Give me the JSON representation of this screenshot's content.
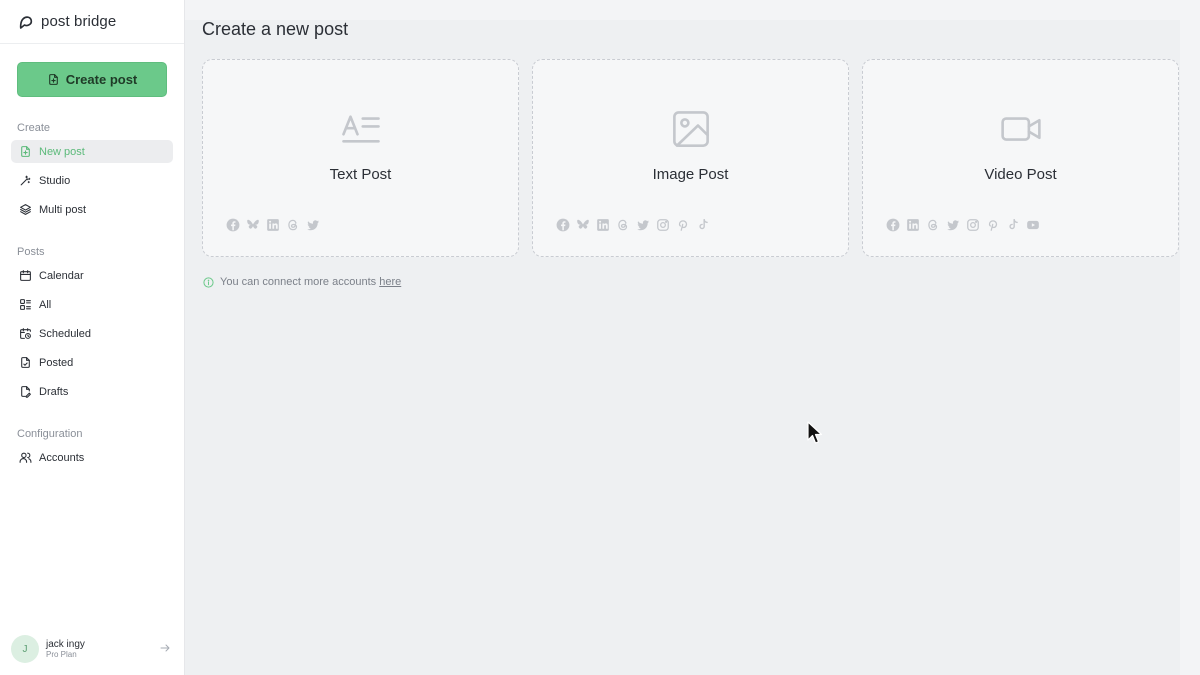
{
  "brand": {
    "name": "post bridge"
  },
  "sidebar": {
    "create_button": "Create post",
    "sections": [
      {
        "label": "Create",
        "items": [
          {
            "label": "New post",
            "icon": "file-plus-icon",
            "active": true
          },
          {
            "label": "Studio",
            "icon": "magic-wand-icon"
          },
          {
            "label": "Multi post",
            "icon": "layers-icon"
          }
        ]
      },
      {
        "label": "Posts",
        "items": [
          {
            "label": "Calendar",
            "icon": "calendar-icon"
          },
          {
            "label": "All",
            "icon": "list-grid-icon"
          },
          {
            "label": "Scheduled",
            "icon": "calendar-clock-icon"
          },
          {
            "label": "Posted",
            "icon": "file-check-icon"
          },
          {
            "label": "Drafts",
            "icon": "file-pen-icon"
          }
        ]
      },
      {
        "label": "Configuration",
        "items": [
          {
            "label": "Accounts",
            "icon": "users-icon"
          }
        ]
      }
    ],
    "user": {
      "initial": "J",
      "name": "jack ingy",
      "plan": "Pro Plan"
    }
  },
  "main": {
    "title": "Create a new post",
    "cards": [
      {
        "title": "Text Post",
        "icon": "text-align-icon",
        "platforms": [
          "facebook",
          "bluesky",
          "linkedin",
          "threads",
          "twitter"
        ]
      },
      {
        "title": "Image Post",
        "icon": "image-icon",
        "platforms": [
          "facebook",
          "bluesky",
          "linkedin",
          "threads",
          "twitter",
          "instagram",
          "pinterest",
          "tiktok"
        ]
      },
      {
        "title": "Video Post",
        "icon": "video-camera-icon",
        "platforms": [
          "facebook",
          "linkedin",
          "threads",
          "twitter",
          "instagram",
          "pinterest",
          "tiktok",
          "youtube"
        ]
      }
    ],
    "info": {
      "text": "You can connect more accounts ",
      "link": "here"
    }
  },
  "colors": {
    "accent": "#6bc98a",
    "active_text": "#5cba7a",
    "muted_icon": "#c4c7cc"
  }
}
